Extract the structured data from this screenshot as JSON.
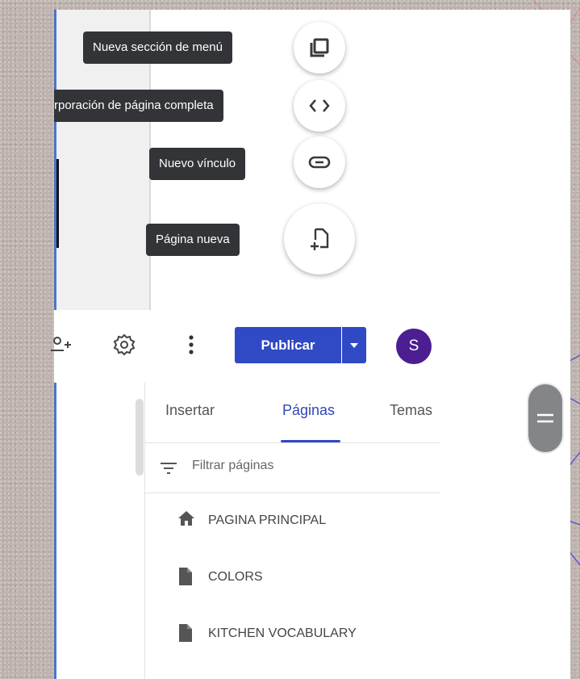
{
  "fab_menu": {
    "items": [
      {
        "tooltip": "Nueva sección de menú",
        "icon": "menu-section-icon"
      },
      {
        "tooltip": "rporación de página completa",
        "icon": "code-icon"
      },
      {
        "tooltip": "Nuevo vínculo",
        "icon": "link-icon"
      },
      {
        "tooltip": "Página nueva",
        "icon": "new-page-icon"
      }
    ]
  },
  "toolbar": {
    "publish_label": "Publicar",
    "avatar_initial": "S",
    "icons": [
      "add-person-icon",
      "gear-icon",
      "more-vert-icon",
      "dropdown-arrow-icon"
    ]
  },
  "side_panel": {
    "tabs": [
      {
        "label": "Insertar",
        "active": false
      },
      {
        "label": "Páginas",
        "active": true
      },
      {
        "label": "Temas",
        "active": false
      }
    ],
    "filter_placeholder": "Filtrar páginas",
    "pages": [
      {
        "label": "PAGINA PRINCIPAL",
        "icon": "home-icon"
      },
      {
        "label": "COLORS",
        "icon": "page-icon"
      },
      {
        "label": "KITCHEN VOCABULARY",
        "icon": "page-icon"
      }
    ]
  },
  "colors": {
    "accent": "#3049c4",
    "avatar": "#4c1e92",
    "tooltip_bg": "#323438"
  }
}
